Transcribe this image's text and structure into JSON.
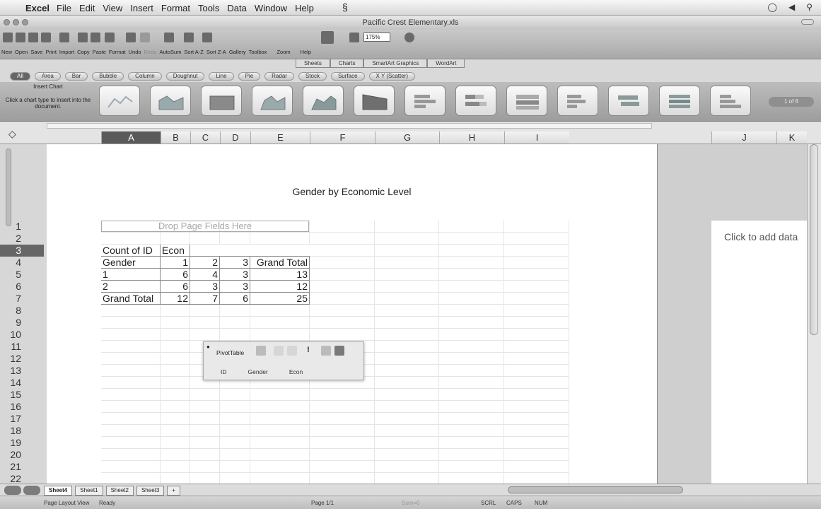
{
  "menubar": {
    "app_name": "Excel",
    "items": [
      "File",
      "Edit",
      "View",
      "Insert",
      "Format",
      "Tools",
      "Data",
      "Window",
      "Help"
    ]
  },
  "window": {
    "title": "Pacific Crest Elementary.xls"
  },
  "toolbar": {
    "labels": [
      "New",
      "Open",
      "Save",
      "Print",
      "Import",
      "Copy",
      "Paste",
      "Format",
      "Undo",
      "Redo",
      "AutoSum",
      "Sort A-Z",
      "Sort Z-A",
      "Gallery",
      "Toolbox",
      "Zoom",
      "Help"
    ],
    "zoom": "175%"
  },
  "ribbon": {
    "tabs": [
      "Sheets",
      "Charts",
      "SmartArt Graphics",
      "WordArt"
    ]
  },
  "chart_types": [
    "All",
    "Area",
    "Bar",
    "Bubble",
    "Column",
    "Doughnut",
    "Line",
    "Pie",
    "Radar",
    "Stock",
    "Surface",
    "X Y (Scatter)"
  ],
  "gallery": {
    "title": "Insert Chart",
    "hint": "Click a chart type to insert into the document.",
    "page": "1 of 6"
  },
  "columns": [
    "A",
    "B",
    "C",
    "D",
    "E",
    "F",
    "G",
    "H",
    "I",
    "J",
    "K"
  ],
  "rows": [
    "1",
    "2",
    "3",
    "4",
    "5",
    "6",
    "7",
    "8",
    "9",
    "10",
    "11",
    "12",
    "13",
    "14",
    "15",
    "16",
    "17",
    "18",
    "19",
    "20",
    "21",
    "22"
  ],
  "sheet": {
    "chart_title": "Gender by Economic Level",
    "drop_text": "Drop Page Fields Here",
    "pivot": [
      [
        "Count of ID",
        "Econ",
        "",
        "",
        ""
      ],
      [
        "Gender",
        "1",
        "2",
        "3",
        "Grand Total"
      ],
      [
        "1",
        "6",
        "4",
        "3",
        "13"
      ],
      [
        "2",
        "6",
        "3",
        "3",
        "12"
      ],
      [
        "Grand Total",
        "12",
        "7",
        "6",
        "25"
      ]
    ],
    "add_data": "Click to add data"
  },
  "pivot_toolbar": {
    "label": "PivotTable",
    "fields": [
      "ID",
      "Gender",
      "Econ"
    ]
  },
  "sheet_tabs": [
    "Sheet4",
    "Sheet1",
    "Sheet2",
    "Sheet3",
    "+"
  ],
  "status": {
    "view": "Page Layout View",
    "ready": "Ready",
    "page": "Page 1/1",
    "sum": "Sum=0",
    "scrl": "SCRL",
    "caps": "CAPS",
    "num": "NUM"
  }
}
